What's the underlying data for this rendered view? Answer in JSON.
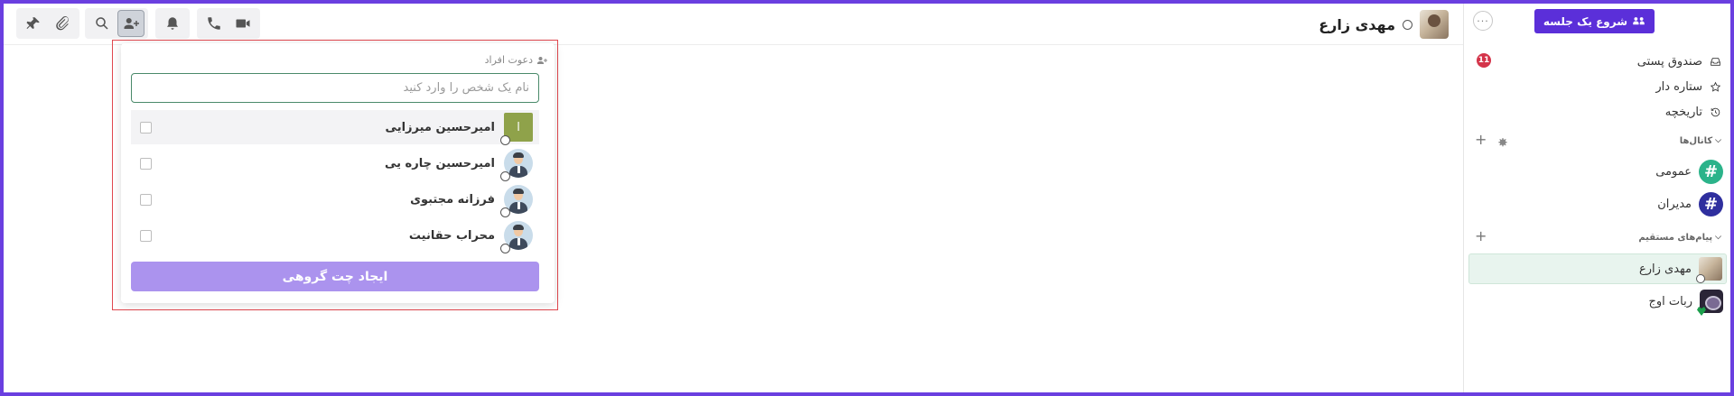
{
  "colors": {
    "accent": "#5b2fd9",
    "create_button": "#ab93ee",
    "badge": "#d4344a",
    "channel_general": "#2bb38a",
    "channel_admins": "#2f2f9e",
    "letter_avatar": "#8fa24a",
    "active_dm_bg": "#e8f4ee",
    "popup_outline": "#e0484f"
  },
  "toolbar": {
    "icons": [
      "pin-icon",
      "attachment-icon",
      "search-icon",
      "add-user-icon",
      "bell-icon",
      "phone-icon",
      "video-icon"
    ]
  },
  "header": {
    "name": "مهدی زارع"
  },
  "invite_popup": {
    "title": "دعوت افراد",
    "search_placeholder": "نام یک شخص را وارد کنید",
    "users": [
      {
        "name": "امیرحسین میرزایی",
        "avatar_letter": "ا",
        "avatar": "letter"
      },
      {
        "name": "امیرحسین چاره یی",
        "avatar": "person"
      },
      {
        "name": "فرزانه مجتبوی",
        "avatar": "person"
      },
      {
        "name": "محراب حقانیت",
        "avatar": "person"
      }
    ],
    "create_button": "ایجاد چت گروهی"
  },
  "sidebar": {
    "start_meeting": "شروع یک جلسه",
    "more": "···",
    "nav": [
      {
        "label": "صندوق پستی",
        "icon": "inbox-icon",
        "badge": "11"
      },
      {
        "label": "ستاره دار",
        "icon": "star-icon"
      },
      {
        "label": "تاریخچه",
        "icon": "history-icon"
      }
    ],
    "channels_header": "کانال‌ها",
    "channels": [
      {
        "label": "عمومی",
        "symbol": "#"
      },
      {
        "label": "مدیران",
        "symbol": "#"
      }
    ],
    "dm_header": "پیام‌های مستقیم",
    "plus": "+",
    "dms": [
      {
        "label": "مهدی زارع",
        "active": true
      },
      {
        "label": "ربات اوج",
        "active": false
      }
    ]
  }
}
